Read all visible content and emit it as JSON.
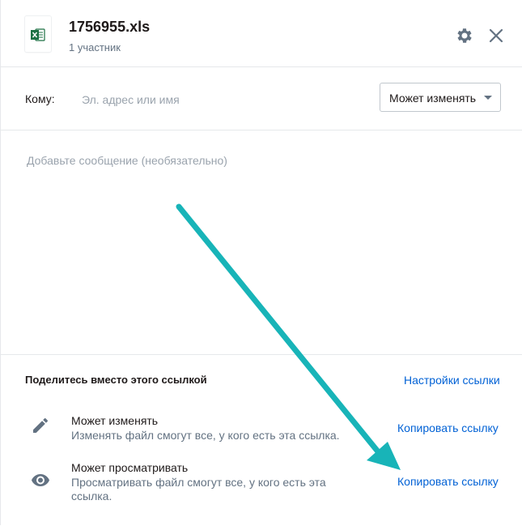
{
  "file": {
    "name": "1756955.xls",
    "participants": "1 участник",
    "icon": "excel-file-icon"
  },
  "header": {
    "settings_icon": "gear-icon",
    "close_icon": "close-icon"
  },
  "to": {
    "label": "Кому:",
    "placeholder": "Эл. адрес или имя",
    "value": ""
  },
  "permission_select": {
    "selected": "Может изменять"
  },
  "message": {
    "placeholder": "Добавьте сообщение (необязательно)"
  },
  "share_link": {
    "title": "Поделитесь вместо этого ссылкой",
    "settings_label": "Настройки ссылки",
    "options": [
      {
        "icon": "pencil-icon",
        "title": "Может изменять",
        "description": "Изменять файл смогут все, у кого есть эта ссылка.",
        "action": "Копировать ссылку"
      },
      {
        "icon": "eye-icon",
        "title": "Может просматривать",
        "description": "Просматривать файл смогут все, у кого есть эта ссылка.",
        "action": "Копировать ссылку"
      }
    ]
  },
  "colors": {
    "link": "#0061d5",
    "arrow": "#18b4b8",
    "excel_green": "#1d7044"
  }
}
